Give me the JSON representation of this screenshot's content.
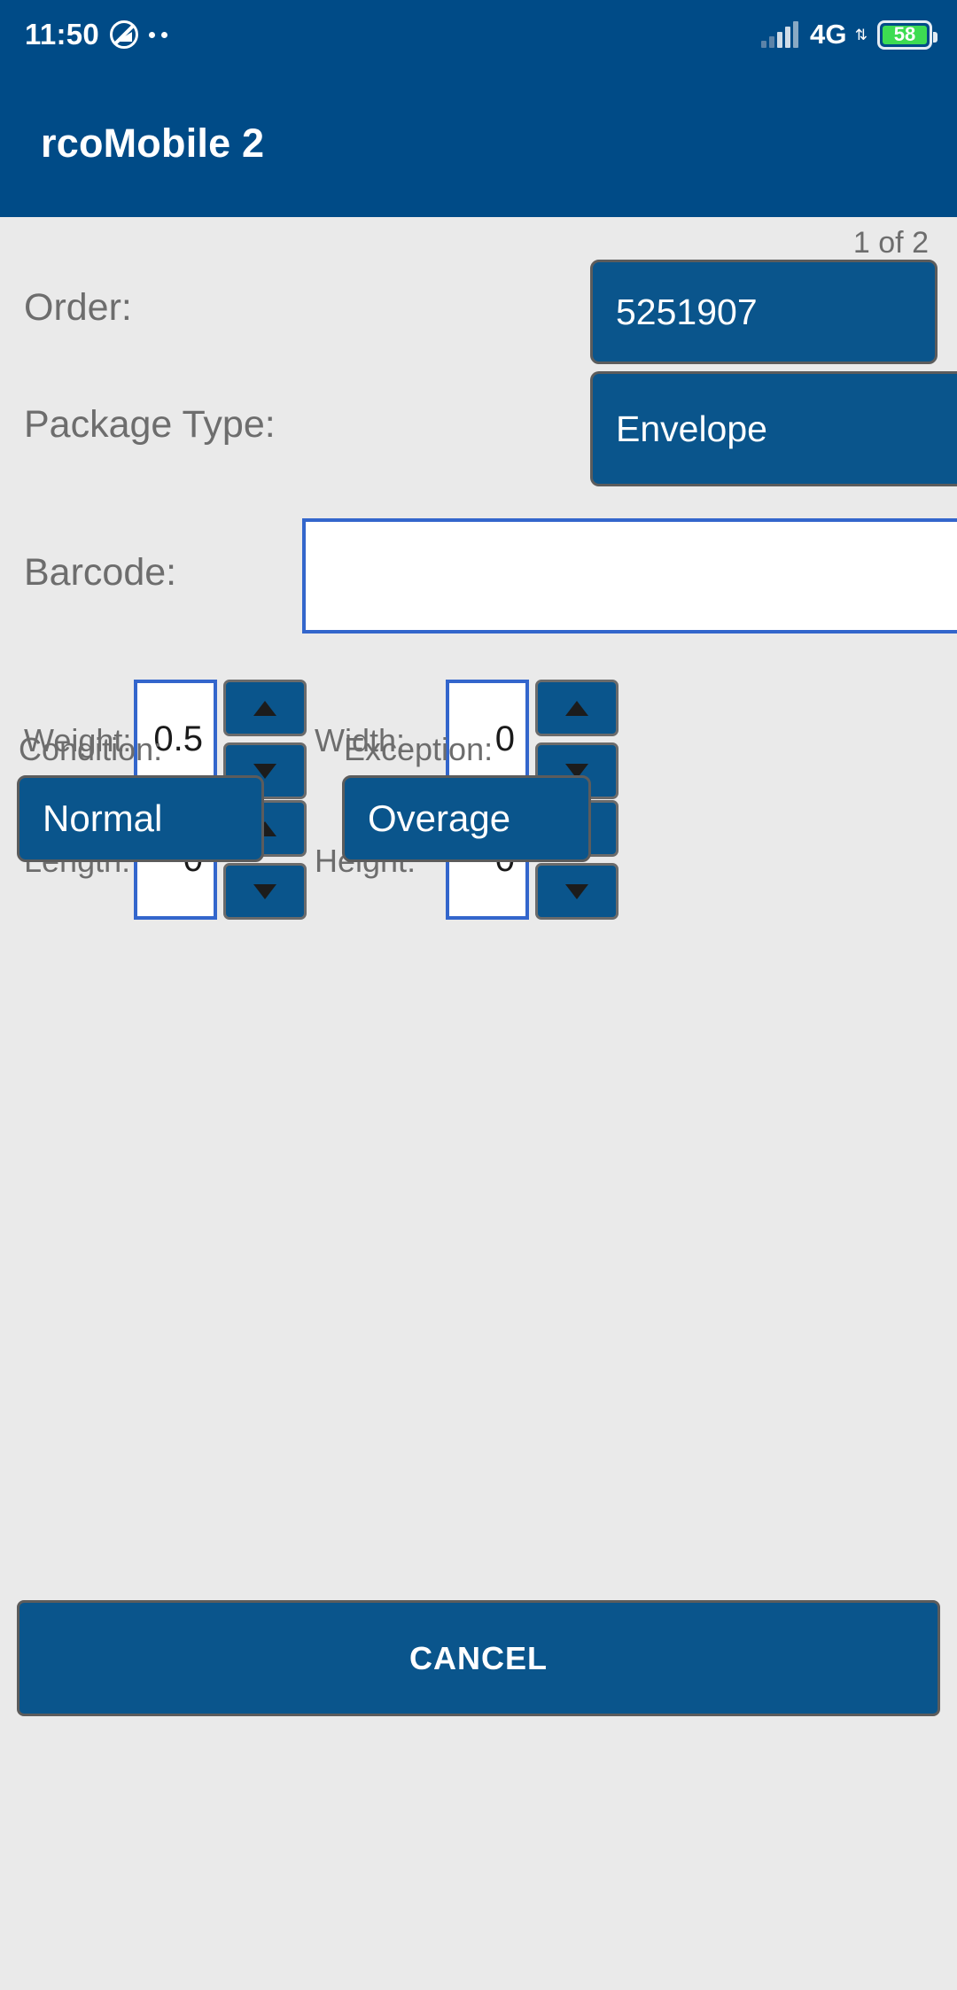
{
  "status_bar": {
    "time": "11:50",
    "dnd_icon": "do-not-disturb-icon",
    "extra_dots": "··",
    "signal_icon": "signal-bars-icon",
    "network": "4G",
    "network_arrows": "⇅",
    "battery_percent": "58",
    "battery_color": "#3ddc52"
  },
  "app_bar": {
    "title": "rcoMobile 2",
    "background_color": "#004b87"
  },
  "content": {
    "page_indicator": "1 of 2",
    "order": {
      "label": "Order:",
      "value": "5251907"
    },
    "package_type": {
      "label": "Package Type:",
      "value": "Envelope"
    },
    "barcode": {
      "label": "Barcode:",
      "value": "",
      "placeholder": ""
    },
    "weight": {
      "label": "Weight:",
      "value": "0.5"
    },
    "width": {
      "label": "Width:",
      "value": "0"
    },
    "length": {
      "label": "Length:",
      "value": "0"
    },
    "height": {
      "label": "Height:",
      "value": "0"
    },
    "condition": {
      "label": "Condition:",
      "value": "Normal"
    },
    "exception": {
      "label": "Exception:",
      "value": "Overage"
    },
    "stepper_up_icon": "chevron-up-icon",
    "stepper_down_icon": "chevron-down-icon"
  },
  "footer": {
    "cancel_label": "CANCEL"
  },
  "colors": {
    "primary": "#004b87",
    "button_blue": "#0a558c",
    "page_background": "#eaeaea",
    "input_border": "#3366cc",
    "label_gray": "#6d6d6d"
  }
}
